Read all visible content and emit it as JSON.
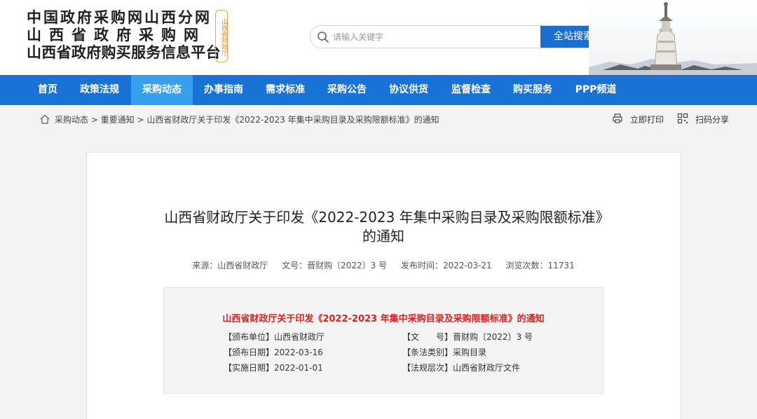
{
  "header": {
    "logo_line1": "中国政府采购网山西分网",
    "logo_line2": "山西省政府采购网",
    "logo_line3": "山西省政府购买服务信息平台",
    "seal_text": "山西省财政厅",
    "search_placeholder": "请输入关键字",
    "search_button": "全站搜索"
  },
  "nav": {
    "items": [
      "首页",
      "政策法规",
      "采购动态",
      "办事指南",
      "需求标准",
      "采购公告",
      "协议供货",
      "监督检查",
      "购买服务",
      "PPP频道"
    ],
    "active": "采购动态"
  },
  "breadcrumb": {
    "text": "采购动态 > 重要通知 > 山西省财政厅关于印发《2022-2023 年集中采购目录及采购限额标准》的通知"
  },
  "tools": {
    "print": "立即打印",
    "share": "扫码分享"
  },
  "article": {
    "title": "山西省财政厅关于印发《2022-2023 年集中采购目录及采购限额标准》的通知",
    "meta_source": "来源：山西省财政厅",
    "meta_doc": "文号：晋财购〔2022〕3 号",
    "meta_date": "发布时间：2022-03-21",
    "meta_views": "浏览次数：11731"
  },
  "info": {
    "title": "山西省财政厅关于印发《2022-2023 年集中采购目录及采购限额标准》的通知",
    "issuer": "【颁布单位】山西省财政厅",
    "doc_no": "【文　　号】晋财购〔2022〕3 号",
    "issue_date": "【颁布日期】2022-03-16",
    "category": "【条法类别】采购目录",
    "effective_date": "【实施日期】2022-01-01",
    "level": "【法规层次】山西省财政厅文件"
  },
  "colors": {
    "nav_bg": "#1972d6",
    "nav_active": "#37a0ec",
    "search_button": "#1c6fd2",
    "info_title": "#e02020"
  }
}
